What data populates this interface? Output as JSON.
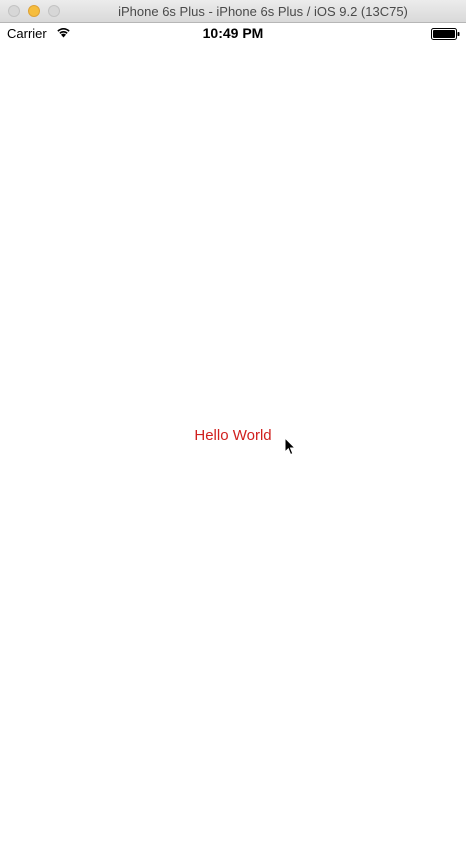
{
  "window": {
    "title": "iPhone 6s Plus - iPhone 6s Plus / iOS 9.2 (13C75)"
  },
  "status_bar": {
    "carrier": "Carrier",
    "time": "10:49 PM",
    "wifi_icon": "wifi-icon",
    "battery_icon": "battery-full-icon",
    "battery_level": 1.0
  },
  "content": {
    "label": "Hello World",
    "label_color": "#d0201e",
    "cursor_icon": "arrow-cursor-icon"
  },
  "colors": {
    "background": "#ffffff",
    "titlebar": "#e3e3e3",
    "minimize_button": "#f6bd3d"
  }
}
